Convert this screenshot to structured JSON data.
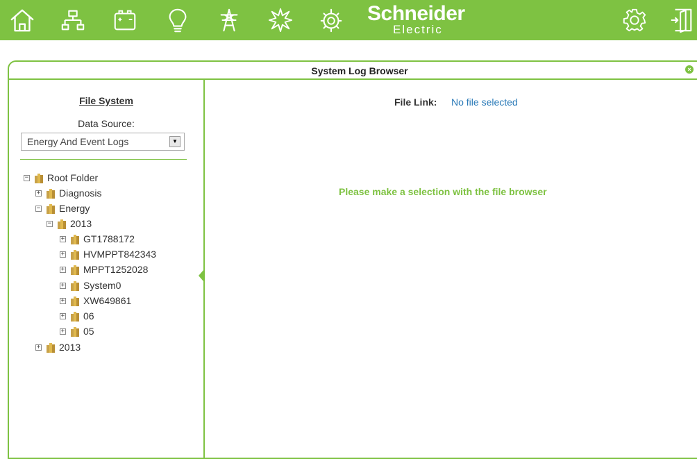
{
  "header": {
    "brand_top": "Schneider",
    "brand_bottom": "Electric",
    "nav": [
      "home-icon",
      "network-icon",
      "battery-icon",
      "bulb-icon",
      "power-tower-icon",
      "burst-icon",
      "power-settings-icon"
    ],
    "actions": [
      "gear-icon",
      "logout-icon"
    ],
    "accent": "#7ec242"
  },
  "window": {
    "title": "System Log Browser",
    "close_icon": "×"
  },
  "left": {
    "title": "File System",
    "data_source_label": "Data Source:",
    "data_source_value": "Energy And Event Logs",
    "tree": [
      {
        "label": "Root Folder",
        "expanded": true
      },
      {
        "label": "Diagnosis",
        "expanded": false
      },
      {
        "label": "Energy",
        "expanded": true
      },
      {
        "label": "2013",
        "expanded": true
      },
      {
        "label": "GT1788172",
        "expanded": false
      },
      {
        "label": "HVMPPT842343",
        "expanded": false
      },
      {
        "label": "MPPT1252028",
        "expanded": false
      },
      {
        "label": "System0",
        "expanded": false
      },
      {
        "label": "XW649861",
        "expanded": false
      },
      {
        "label": "06",
        "expanded": false
      },
      {
        "label": "05",
        "expanded": false
      },
      {
        "label": "2013",
        "expanded": false
      }
    ]
  },
  "right": {
    "file_link_label": "File Link:",
    "file_link_value": "No file selected",
    "message": "Please make a selection with the file browser"
  }
}
